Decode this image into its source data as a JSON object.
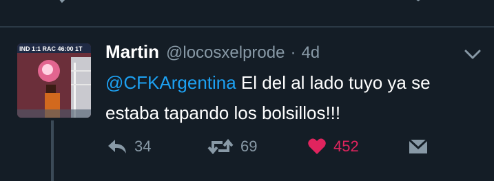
{
  "tweet": {
    "author_name": "Martin",
    "author_handle": "@locosxelprode",
    "separator": "·",
    "time": "4d",
    "mention": "@CFKArgentina",
    "text": " El del al lado tuyo ya se estaba tapando los bolsillos!!!",
    "reply_count": "34",
    "retweet_count": "69",
    "like_count": "452",
    "liked": true
  },
  "avatar": {
    "scoreboard_text": "IND 1:1 RAC 46:00 1T"
  },
  "icons": {
    "reply": "reply-icon",
    "retweet": "retweet-icon",
    "like": "heart-icon",
    "message": "envelope-icon",
    "more": "chevron-down-icon"
  },
  "colors": {
    "background": "#141d26",
    "mention": "#1da1f2",
    "muted": "#8899a6",
    "like": "#e0245e",
    "divider": "#2b3945"
  }
}
